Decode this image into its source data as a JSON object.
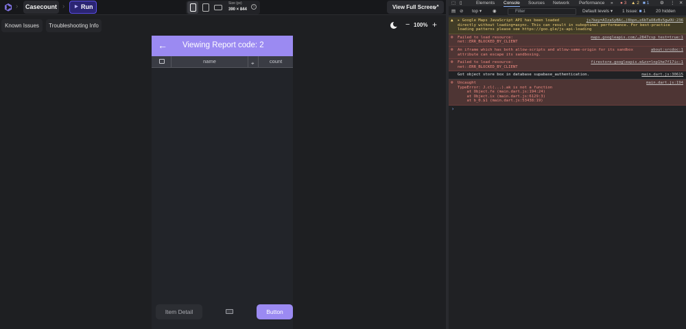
{
  "app": {
    "project_name": "Casecount",
    "run_label": "Run",
    "size_label": "Size (px)",
    "size_value": "390 × 844",
    "full_screen_label": "View Full Screen",
    "subbar": {
      "known_issues": "Known Issues",
      "troubleshooting": "Troubleshooting Info"
    },
    "zoom": {
      "minus": "−",
      "value": "100%",
      "plus": "+"
    }
  },
  "phone": {
    "header_title": "Viewing Report code: 2",
    "columns": {
      "name": "name",
      "count": "count"
    },
    "item_detail_label": "Item Detail",
    "button_label": "Button",
    "accent": "#9b8af2"
  },
  "devtools": {
    "tabs": [
      "Elements",
      "Console",
      "Sources",
      "Network",
      "Performance",
      "»"
    ],
    "active_tab": "Console",
    "badges": {
      "errors": "3",
      "warnings": "2",
      "info": "1"
    },
    "toolbar": {
      "context": "top",
      "filter_placeholder": "Filter",
      "levels": "Default levels",
      "issues": "1 Issue:",
      "issues_count": "1",
      "hidden": "20 hidden"
    },
    "messages": [
      {
        "level": "warn",
        "lines": [
          "▸ Google Maps JavaScript API has been loaded",
          "directly without loading=async. This can result in suboptimal performance. For best-practice",
          "loading patterns please see https://goo.gle/js-api-loading"
        ],
        "source": "js?key=AIzaSyBA(…)8bpn…s6bTaO8zBs5gwOU:236"
      },
      {
        "level": "err",
        "lines": [
          "Failed to load resource:",
          "net::ERR_BLOCKED_BY_CLIENT"
        ],
        "source": "maps.googleapis.com/…2847csp_test=true:1"
      },
      {
        "level": "err",
        "lines": [
          "An iframe which has both allow-scripts and allow-same-origin for its sandbox",
          "attribute can escape its sandboxing."
        ],
        "source": "about:srcdoc:1"
      },
      {
        "level": "err",
        "lines": [
          "Failed to load resource:",
          "net::ERR_BLOCKED_BY_CLIENT"
        ],
        "source": "firestore.googleapis.e&zx=lnp1he7f17ic:1"
      },
      {
        "level": "info",
        "lines": [
          "Got object store box in database supabase_authentication."
        ],
        "source": "main.dart.js:30615"
      },
      {
        "level": "err",
        "lines": [
          "Uncaught",
          "TypeError: J.cl(...).ak is not a function",
          "    at Object.fe (main.dart.js:194:24)",
          "    at Object.ix (main.dart.js:6129:3)",
          "    at b_0.$1 (main.dart.js:53438:19)"
        ],
        "source": "main.dart.js:194"
      }
    ],
    "prompt": "›"
  }
}
